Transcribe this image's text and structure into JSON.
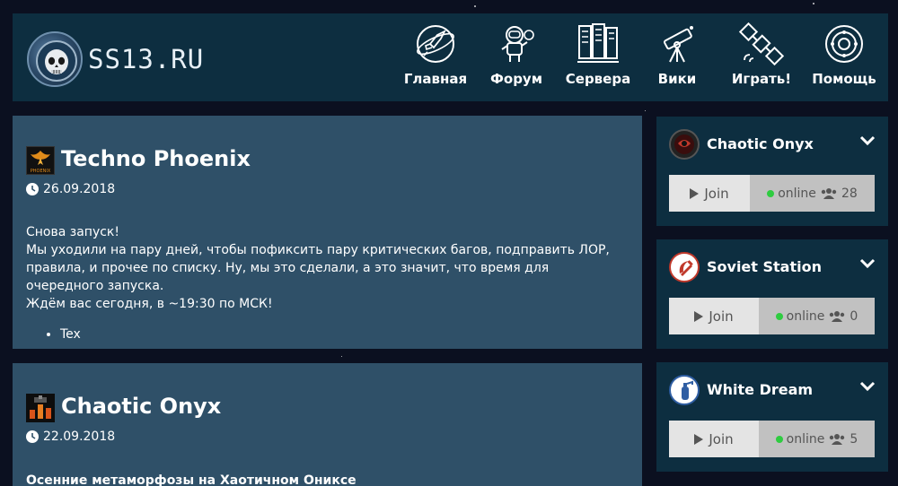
{
  "site": {
    "brand": "SS13.RU"
  },
  "nav": [
    {
      "label": "Главная",
      "icon": "rocket-icon"
    },
    {
      "label": "Форум",
      "icon": "astronaut-icon"
    },
    {
      "label": "Сервера",
      "icon": "server-rack-icon"
    },
    {
      "label": "Вики",
      "icon": "telescope-icon"
    },
    {
      "label": "Играть!",
      "icon": "satellite-icon"
    },
    {
      "label": "Помощь",
      "icon": "lifebuoy-icon"
    }
  ],
  "posts": [
    {
      "title": "Techno Phoenix",
      "avatar_text": "PHOENIX",
      "date": "26.09.2018",
      "body": [
        "Снова запуск!",
        "Мы уходили на пару дней, чтобы пофиксить пару критических багов, подправить ЛОР, правила, и прочее по списку. Ну, мы это сделали, а это значит, что время для очередного запуска.",
        "Ждём вас сегодня, в ~19:30 по МСК!"
      ],
      "list": [
        "Tex"
      ]
    },
    {
      "title": "Chaotic Onyx",
      "date": "22.09.2018",
      "subheading": "Осенние метаморфозы на Хаотичном Ониксе"
    }
  ],
  "servers": [
    {
      "name": "Chaotic Onyx",
      "join": "Join",
      "status": "online",
      "players": "28"
    },
    {
      "name": "Soviet Station",
      "join": "Join",
      "status": "online",
      "players": "0"
    },
    {
      "name": "White Dream",
      "join": "Join",
      "status": "online",
      "players": "5"
    }
  ],
  "colors": {
    "background": "#0b1020",
    "panel": "#0d2e40",
    "post": "#2f5068",
    "join_bg": "#e4e4e4",
    "status_bg": "#c1c1c1",
    "online_dot": "#2ecc40"
  }
}
